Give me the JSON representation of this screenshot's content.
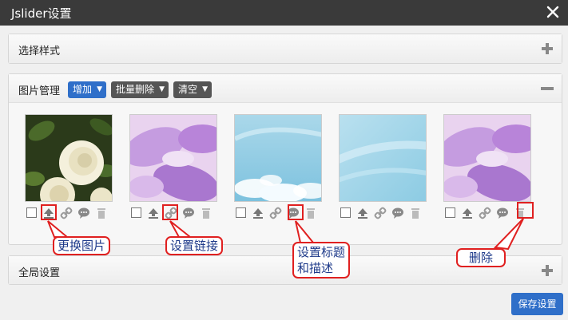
{
  "dialog": {
    "title": "Jslider设置"
  },
  "style_panel": {
    "label": "选择样式"
  },
  "images_panel": {
    "label": "图片管理",
    "add_label": "增加",
    "batch_delete_label": "批量删除",
    "clear_label": "清空"
  },
  "global_panel": {
    "label": "全局设置"
  },
  "images": [
    {
      "name": "white-roses"
    },
    {
      "name": "purple-flower"
    },
    {
      "name": "sky-clouds"
    },
    {
      "name": "sky-blue"
    },
    {
      "name": "purple-flower"
    }
  ],
  "annotations": {
    "replace_image": "更换图片",
    "set_link": "设置链接",
    "set_title_line1": "设置标题",
    "set_title_line2": "和描述",
    "delete": "删除"
  },
  "footer": {
    "save_label": "保存设置"
  },
  "colors": {
    "primary": "#2f6fc9",
    "annotation_red": "#e02020",
    "titlebar": "#3a3a3a"
  }
}
